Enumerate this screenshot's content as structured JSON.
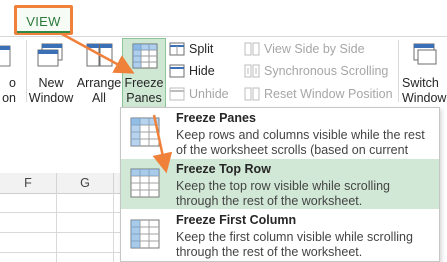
{
  "ribbon": {
    "active_tab": "VIEW",
    "buttons": {
      "partial_left_line1": "o",
      "partial_left_line2": "on",
      "new_window_line1": "New",
      "new_window_line2": "Window",
      "arrange_all_line1": "Arrange",
      "arrange_all_line2": "All",
      "freeze_panes_line1": "Freeze",
      "freeze_panes_line2": "Panes ▾",
      "split": "Split",
      "hide": "Hide",
      "unhide": "Unhide",
      "view_side_by_side": "View Side by Side",
      "synchronous_scrolling": "Synchronous Scrolling",
      "reset_window_position": "Reset Window Position",
      "switch_windows_line1": "Switch",
      "switch_windows_line2": "Window"
    }
  },
  "sheet": {
    "columns": [
      "F",
      "G"
    ]
  },
  "menu": {
    "items": [
      {
        "title": "Freeze Panes",
        "description": "Keep rows and columns visible while the rest of the worksheet scrolls (based on current selection)."
      },
      {
        "title": "Freeze Top Row",
        "description": "Keep the top row visible while scrolling through the rest of the worksheet."
      },
      {
        "title": "Freeze First Column",
        "description": "Keep the first column visible while scrolling through the rest of the worksheet."
      }
    ]
  },
  "colors": {
    "accent_green": "#2b7a3d",
    "highlight_green": "#d1e8d6",
    "callout_orange": "#f0813a"
  }
}
